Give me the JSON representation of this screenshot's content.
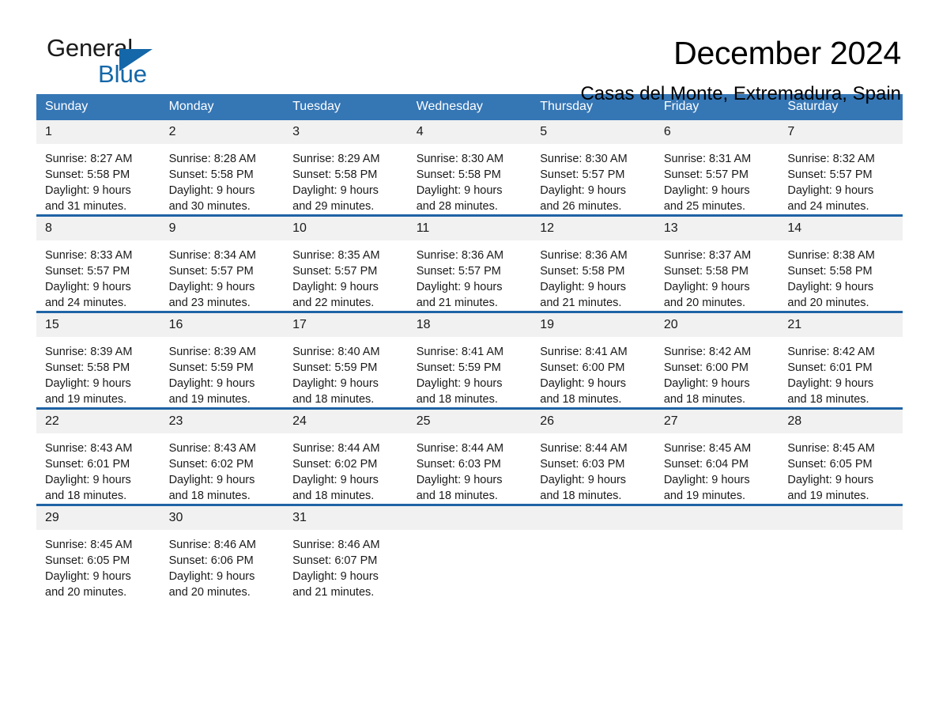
{
  "brand": {
    "name_part1": "General",
    "name_part2": "Blue",
    "triangle_color": "#1467a8",
    "blue_color": "#1467a8"
  },
  "header": {
    "title": "December 2024",
    "subtitle": "Casas del Monte, Extremadura, Spain"
  },
  "theme": {
    "header_blue": "#3576b5",
    "row_divider_blue": "#1f63a6",
    "daynum_bg": "#f1f1f1"
  },
  "weekdays": [
    "Sunday",
    "Monday",
    "Tuesday",
    "Wednesday",
    "Thursday",
    "Friday",
    "Saturday"
  ],
  "labels": {
    "sunrise_prefix": "Sunrise:",
    "sunset_prefix": "Sunset:",
    "daylight_prefix": "Daylight:"
  },
  "weeks": [
    [
      {
        "day": "1",
        "sunrise": "Sunrise: 8:27 AM",
        "sunset": "Sunset: 5:58 PM",
        "daylight1": "Daylight: 9 hours",
        "daylight2": "and 31 minutes."
      },
      {
        "day": "2",
        "sunrise": "Sunrise: 8:28 AM",
        "sunset": "Sunset: 5:58 PM",
        "daylight1": "Daylight: 9 hours",
        "daylight2": "and 30 minutes."
      },
      {
        "day": "3",
        "sunrise": "Sunrise: 8:29 AM",
        "sunset": "Sunset: 5:58 PM",
        "daylight1": "Daylight: 9 hours",
        "daylight2": "and 29 minutes."
      },
      {
        "day": "4",
        "sunrise": "Sunrise: 8:30 AM",
        "sunset": "Sunset: 5:58 PM",
        "daylight1": "Daylight: 9 hours",
        "daylight2": "and 28 minutes."
      },
      {
        "day": "5",
        "sunrise": "Sunrise: 8:30 AM",
        "sunset": "Sunset: 5:57 PM",
        "daylight1": "Daylight: 9 hours",
        "daylight2": "and 26 minutes."
      },
      {
        "day": "6",
        "sunrise": "Sunrise: 8:31 AM",
        "sunset": "Sunset: 5:57 PM",
        "daylight1": "Daylight: 9 hours",
        "daylight2": "and 25 minutes."
      },
      {
        "day": "7",
        "sunrise": "Sunrise: 8:32 AM",
        "sunset": "Sunset: 5:57 PM",
        "daylight1": "Daylight: 9 hours",
        "daylight2": "and 24 minutes."
      }
    ],
    [
      {
        "day": "8",
        "sunrise": "Sunrise: 8:33 AM",
        "sunset": "Sunset: 5:57 PM",
        "daylight1": "Daylight: 9 hours",
        "daylight2": "and 24 minutes."
      },
      {
        "day": "9",
        "sunrise": "Sunrise: 8:34 AM",
        "sunset": "Sunset: 5:57 PM",
        "daylight1": "Daylight: 9 hours",
        "daylight2": "and 23 minutes."
      },
      {
        "day": "10",
        "sunrise": "Sunrise: 8:35 AM",
        "sunset": "Sunset: 5:57 PM",
        "daylight1": "Daylight: 9 hours",
        "daylight2": "and 22 minutes."
      },
      {
        "day": "11",
        "sunrise": "Sunrise: 8:36 AM",
        "sunset": "Sunset: 5:57 PM",
        "daylight1": "Daylight: 9 hours",
        "daylight2": "and 21 minutes."
      },
      {
        "day": "12",
        "sunrise": "Sunrise: 8:36 AM",
        "sunset": "Sunset: 5:58 PM",
        "daylight1": "Daylight: 9 hours",
        "daylight2": "and 21 minutes."
      },
      {
        "day": "13",
        "sunrise": "Sunrise: 8:37 AM",
        "sunset": "Sunset: 5:58 PM",
        "daylight1": "Daylight: 9 hours",
        "daylight2": "and 20 minutes."
      },
      {
        "day": "14",
        "sunrise": "Sunrise: 8:38 AM",
        "sunset": "Sunset: 5:58 PM",
        "daylight1": "Daylight: 9 hours",
        "daylight2": "and 20 minutes."
      }
    ],
    [
      {
        "day": "15",
        "sunrise": "Sunrise: 8:39 AM",
        "sunset": "Sunset: 5:58 PM",
        "daylight1": "Daylight: 9 hours",
        "daylight2": "and 19 minutes."
      },
      {
        "day": "16",
        "sunrise": "Sunrise: 8:39 AM",
        "sunset": "Sunset: 5:59 PM",
        "daylight1": "Daylight: 9 hours",
        "daylight2": "and 19 minutes."
      },
      {
        "day": "17",
        "sunrise": "Sunrise: 8:40 AM",
        "sunset": "Sunset: 5:59 PM",
        "daylight1": "Daylight: 9 hours",
        "daylight2": "and 18 minutes."
      },
      {
        "day": "18",
        "sunrise": "Sunrise: 8:41 AM",
        "sunset": "Sunset: 5:59 PM",
        "daylight1": "Daylight: 9 hours",
        "daylight2": "and 18 minutes."
      },
      {
        "day": "19",
        "sunrise": "Sunrise: 8:41 AM",
        "sunset": "Sunset: 6:00 PM",
        "daylight1": "Daylight: 9 hours",
        "daylight2": "and 18 minutes."
      },
      {
        "day": "20",
        "sunrise": "Sunrise: 8:42 AM",
        "sunset": "Sunset: 6:00 PM",
        "daylight1": "Daylight: 9 hours",
        "daylight2": "and 18 minutes."
      },
      {
        "day": "21",
        "sunrise": "Sunrise: 8:42 AM",
        "sunset": "Sunset: 6:01 PM",
        "daylight1": "Daylight: 9 hours",
        "daylight2": "and 18 minutes."
      }
    ],
    [
      {
        "day": "22",
        "sunrise": "Sunrise: 8:43 AM",
        "sunset": "Sunset: 6:01 PM",
        "daylight1": "Daylight: 9 hours",
        "daylight2": "and 18 minutes."
      },
      {
        "day": "23",
        "sunrise": "Sunrise: 8:43 AM",
        "sunset": "Sunset: 6:02 PM",
        "daylight1": "Daylight: 9 hours",
        "daylight2": "and 18 minutes."
      },
      {
        "day": "24",
        "sunrise": "Sunrise: 8:44 AM",
        "sunset": "Sunset: 6:02 PM",
        "daylight1": "Daylight: 9 hours",
        "daylight2": "and 18 minutes."
      },
      {
        "day": "25",
        "sunrise": "Sunrise: 8:44 AM",
        "sunset": "Sunset: 6:03 PM",
        "daylight1": "Daylight: 9 hours",
        "daylight2": "and 18 minutes."
      },
      {
        "day": "26",
        "sunrise": "Sunrise: 8:44 AM",
        "sunset": "Sunset: 6:03 PM",
        "daylight1": "Daylight: 9 hours",
        "daylight2": "and 18 minutes."
      },
      {
        "day": "27",
        "sunrise": "Sunrise: 8:45 AM",
        "sunset": "Sunset: 6:04 PM",
        "daylight1": "Daylight: 9 hours",
        "daylight2": "and 19 minutes."
      },
      {
        "day": "28",
        "sunrise": "Sunrise: 8:45 AM",
        "sunset": "Sunset: 6:05 PM",
        "daylight1": "Daylight: 9 hours",
        "daylight2": "and 19 minutes."
      }
    ],
    [
      {
        "day": "29",
        "sunrise": "Sunrise: 8:45 AM",
        "sunset": "Sunset: 6:05 PM",
        "daylight1": "Daylight: 9 hours",
        "daylight2": "and 20 minutes."
      },
      {
        "day": "30",
        "sunrise": "Sunrise: 8:46 AM",
        "sunset": "Sunset: 6:06 PM",
        "daylight1": "Daylight: 9 hours",
        "daylight2": "and 20 minutes."
      },
      {
        "day": "31",
        "sunrise": "Sunrise: 8:46 AM",
        "sunset": "Sunset: 6:07 PM",
        "daylight1": "Daylight: 9 hours",
        "daylight2": "and 21 minutes."
      },
      {
        "day": "",
        "sunrise": "",
        "sunset": "",
        "daylight1": "",
        "daylight2": ""
      },
      {
        "day": "",
        "sunrise": "",
        "sunset": "",
        "daylight1": "",
        "daylight2": ""
      },
      {
        "day": "",
        "sunrise": "",
        "sunset": "",
        "daylight1": "",
        "daylight2": ""
      },
      {
        "day": "",
        "sunrise": "",
        "sunset": "",
        "daylight1": "",
        "daylight2": ""
      }
    ]
  ]
}
